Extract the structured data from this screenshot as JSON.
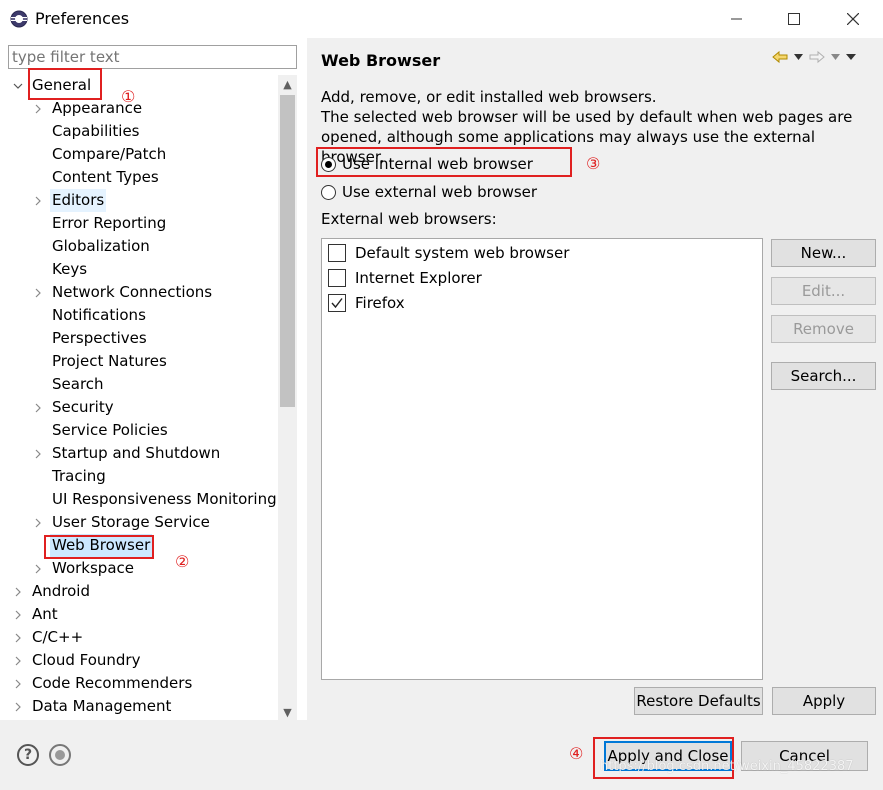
{
  "window": {
    "title": "Preferences",
    "controls": {
      "minimize": "—",
      "maximize": "☐",
      "close": "✕"
    }
  },
  "filter": {
    "placeholder": "type filter text"
  },
  "tree": {
    "items": [
      {
        "label": "General",
        "expanded": true,
        "level": 0
      },
      {
        "label": "Appearance",
        "expandable": true,
        "level": 1
      },
      {
        "label": "Capabilities",
        "level": 1
      },
      {
        "label": "Compare/Patch",
        "level": 1
      },
      {
        "label": "Content Types",
        "level": 1
      },
      {
        "label": "Editors",
        "expandable": true,
        "level": 1
      },
      {
        "label": "Error Reporting",
        "level": 1
      },
      {
        "label": "Globalization",
        "level": 1
      },
      {
        "label": "Keys",
        "level": 1
      },
      {
        "label": "Network Connections",
        "expandable": true,
        "level": 1
      },
      {
        "label": "Notifications",
        "level": 1
      },
      {
        "label": "Perspectives",
        "level": 1
      },
      {
        "label": "Project Natures",
        "level": 1
      },
      {
        "label": "Search",
        "level": 1
      },
      {
        "label": "Security",
        "expandable": true,
        "level": 1
      },
      {
        "label": "Service Policies",
        "level": 1
      },
      {
        "label": "Startup and Shutdown",
        "expandable": true,
        "level": 1
      },
      {
        "label": "Tracing",
        "level": 1
      },
      {
        "label": "UI Responsiveness Monitoring",
        "level": 1
      },
      {
        "label": "User Storage Service",
        "expandable": true,
        "level": 1
      },
      {
        "label": "Web Browser",
        "level": 1,
        "selected": true
      },
      {
        "label": "Workspace",
        "expandable": true,
        "level": 1
      },
      {
        "label": "Android",
        "expandable": true,
        "level": 0
      },
      {
        "label": "Ant",
        "expandable": true,
        "level": 0
      },
      {
        "label": "C/C++",
        "expandable": true,
        "level": 0
      },
      {
        "label": "Cloud Foundry",
        "expandable": true,
        "level": 0
      },
      {
        "label": "Code Recommenders",
        "expandable": true,
        "level": 0
      },
      {
        "label": "Data Management",
        "expandable": true,
        "level": 0
      }
    ]
  },
  "page": {
    "title": "Web Browser",
    "description_lines": [
      "Add, remove, or edit installed web browsers.",
      "The selected web browser will be used by default when web pages are",
      "opened, although some applications may always use the external browser."
    ],
    "radio_internal": "Use internal web browser",
    "radio_external": "Use external web browser",
    "selected_radio": "internal",
    "external_label": "External web browsers:",
    "browsers": [
      {
        "name": "Default system web browser",
        "checked": false
      },
      {
        "name": "Internet Explorer",
        "checked": false
      },
      {
        "name": "Firefox",
        "checked": true
      }
    ],
    "buttons": {
      "new": "New...",
      "edit": "Edit...",
      "remove": "Remove",
      "search": "Search...",
      "restore_defaults": "Restore Defaults",
      "apply": "Apply"
    }
  },
  "bottom": {
    "apply_and_close": "Apply and Close",
    "cancel": "Cancel",
    "help_glyph": "?"
  },
  "annotations": {
    "one": "①",
    "two": "②",
    "three": "③",
    "four": "④"
  },
  "watermark": "https://blog.csdn.net/weixin_45822387",
  "colors": {
    "annotation_red": "#e02020",
    "selection": "#cce8ff",
    "default_button_border": "#0078d7"
  }
}
